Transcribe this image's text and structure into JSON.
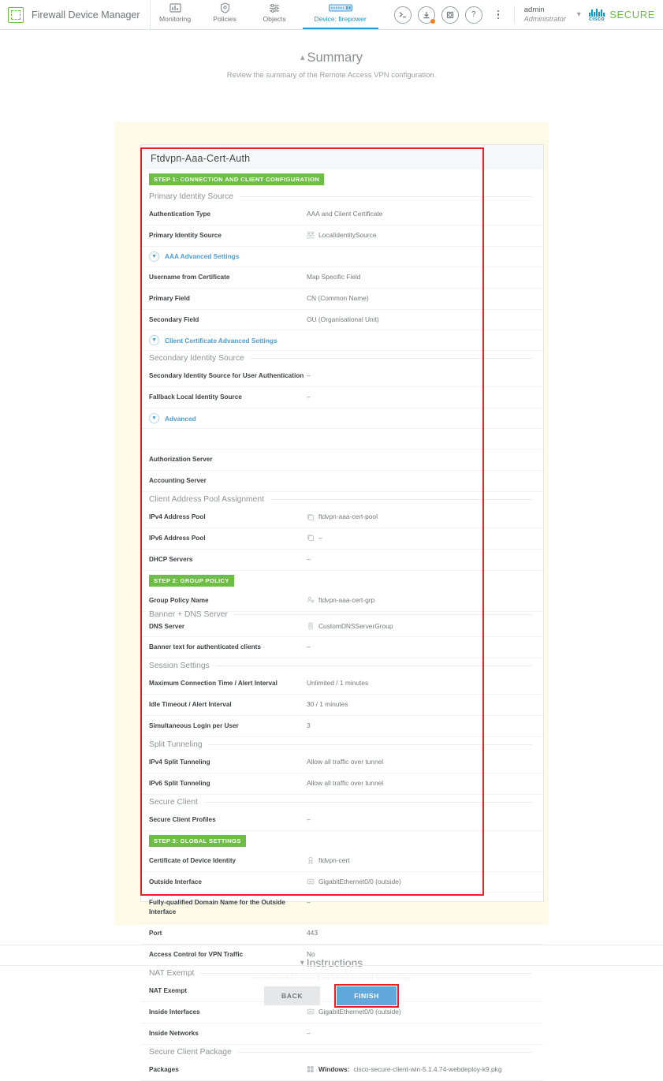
{
  "header": {
    "brand": "Firewall Device Manager",
    "brand_logo_icon": "firewall-logo-icon",
    "tabs": [
      {
        "label": "Monitoring",
        "icon": "monitoring-icon",
        "active": false
      },
      {
        "label": "Policies",
        "icon": "shield-icon",
        "active": false
      },
      {
        "label": "Objects",
        "icon": "objects-icon",
        "active": false
      },
      {
        "label": "Device: firepower",
        "icon": "device-icon",
        "active": true
      }
    ],
    "actions": [
      {
        "name": "cli-console-icon",
        "glyph": ">_"
      },
      {
        "name": "deploy-icon",
        "glyph": "⤓",
        "badge": true
      },
      {
        "name": "tasks-icon",
        "glyph": "◎"
      },
      {
        "name": "help-icon",
        "glyph": "?"
      }
    ],
    "more_icon": "kebab-menu-icon",
    "user": {
      "name": "admin",
      "role": "Administrator"
    },
    "user_chevron_icon": "chevron-down-icon",
    "cisco_logo": "cisco-logo-icon",
    "cisco_word": "cisco",
    "secure_word": "SECURE"
  },
  "summary": {
    "chevron_icon": "chevron-up-icon",
    "title": "Summary",
    "subtitle": "Review the summary of the Remote Access VPN configuration."
  },
  "card": {
    "title": "Ftdvpn-Aaa-Cert-Auth",
    "blocks": [
      {
        "type": "badge",
        "label": "STEP 1: CONNECTION AND CLIENT CONFIGURATION"
      },
      {
        "type": "section",
        "label": "Primary Identity Source"
      },
      {
        "type": "row",
        "key": "Authentication Type",
        "value": "AAA and Client Certificate",
        "icon": ""
      },
      {
        "type": "row",
        "key": "Primary Identity Source",
        "value": "LocalIdentitySource",
        "icon": "identity-source-icon"
      },
      {
        "type": "link",
        "label": "AAA Advanced Settings",
        "icon": "chevron-down-circle-icon"
      },
      {
        "type": "row",
        "key": "Username from Certificate",
        "value": "Map Specific Field",
        "icon": ""
      },
      {
        "type": "row",
        "key": "Primary Field",
        "value": "CN (Common Name)",
        "icon": ""
      },
      {
        "type": "row",
        "key": "Secondary Field",
        "value": "OU (Organisational Unit)",
        "icon": ""
      },
      {
        "type": "link",
        "label": "Client Certificate Advanced Settings",
        "icon": "chevron-down-circle-icon"
      },
      {
        "type": "section",
        "label": "Secondary Identity Source"
      },
      {
        "type": "row",
        "key": "Secondary Identity Source for User Authentication",
        "value": "–",
        "icon": ""
      },
      {
        "type": "row",
        "key": "Fallback Local Identity Source",
        "value": "–",
        "icon": ""
      },
      {
        "type": "link",
        "label": "Advanced",
        "icon": "chevron-down-circle-icon"
      },
      {
        "type": "spacer"
      },
      {
        "type": "row",
        "key": "Authorization Server",
        "value": "",
        "icon": ""
      },
      {
        "type": "row",
        "key": "Accounting Server",
        "value": "",
        "icon": ""
      },
      {
        "type": "section",
        "label": "Client Address Pool Assignment"
      },
      {
        "type": "row",
        "key": "IPv4 Address Pool",
        "value": "ftdvpn-aaa-cert-pool",
        "icon": "network-object-icon"
      },
      {
        "type": "row",
        "key": "IPv6 Address Pool",
        "value": "–",
        "icon": "network-object-icon"
      },
      {
        "type": "row",
        "key": "DHCP Servers",
        "value": "–",
        "icon": ""
      },
      {
        "type": "badge",
        "label": "STEP 2: GROUP POLICY"
      },
      {
        "type": "row",
        "key": "Group Policy Name",
        "value": "ftdvpn-aaa-cert-grp",
        "icon": "group-policy-icon"
      },
      {
        "type": "section",
        "label": "Banner + DNS Server"
      },
      {
        "type": "row",
        "key": "DNS Server",
        "value": "CustomDNSServerGroup",
        "icon": "dns-server-icon"
      },
      {
        "type": "row",
        "key": "Banner text for authenticated clients",
        "value": "–",
        "icon": ""
      },
      {
        "type": "section",
        "label": "Session Settings"
      },
      {
        "type": "row",
        "key": "Maximum Connection Time / Alert Interval",
        "value": "Unlimited / 1 minutes",
        "icon": ""
      },
      {
        "type": "row",
        "key": "Idle Timeout / Alert Interval",
        "value": "30 / 1 minutes",
        "icon": ""
      },
      {
        "type": "row",
        "key": "Simultaneous Login per User",
        "value": "3",
        "icon": ""
      },
      {
        "type": "section",
        "label": "Split Tunneling"
      },
      {
        "type": "row",
        "key": "IPv4 Split Tunneling",
        "value": "Allow all traffic over tunnel",
        "icon": ""
      },
      {
        "type": "row",
        "key": "IPv6 Split Tunneling",
        "value": "Allow all traffic over tunnel",
        "icon": ""
      },
      {
        "type": "section",
        "label": "Secure Client"
      },
      {
        "type": "row",
        "key": "Secure Client Profiles",
        "value": "–",
        "icon": ""
      },
      {
        "type": "badge",
        "label": "STEP 3: GLOBAL SETTINGS"
      },
      {
        "type": "row",
        "key": "Certificate of Device Identity",
        "value": "ftdvpn-cert",
        "icon": "certificate-icon"
      },
      {
        "type": "row",
        "key": "Outside Interface",
        "value": "GigabitEthernet0/0 (outside)",
        "icon": "interface-icon"
      },
      {
        "type": "row",
        "key": "Fully-qualified Domain Name for the Outside Interface",
        "value": "–",
        "icon": ""
      },
      {
        "type": "row",
        "key": "Port",
        "value": "443",
        "icon": ""
      },
      {
        "type": "row",
        "key": "Access Control for VPN Traffic",
        "value": "No",
        "icon": ""
      },
      {
        "type": "section",
        "label": "NAT Exempt"
      },
      {
        "type": "row",
        "key": "NAT Exempt",
        "value": "No",
        "icon": ""
      },
      {
        "type": "row",
        "key": "Inside Interfaces",
        "value": "GigabitEthernet0/0 (outside)",
        "icon": "interface-icon"
      },
      {
        "type": "row",
        "key": "Inside Networks",
        "value": "–",
        "icon": ""
      },
      {
        "type": "section",
        "label": "Secure Client Package"
      },
      {
        "type": "row",
        "key": "Packages",
        "value": "cisco-secure-client-win-5.1.4.74-webdeploy-k9.pkg",
        "value_prefix": "Windows:",
        "icon": "package-icon"
      }
    ]
  },
  "instructions": {
    "chevron_icon": "chevron-down-icon",
    "title": "Instructions",
    "faded_text": "Instructions for your End Users to start connecting"
  },
  "footer": {
    "back_label": "BACK",
    "finish_label": "FINISH"
  },
  "colors": {
    "accent_blue": "#1f9ad6",
    "green": "#6cbe45",
    "annotation_red": "#ee1d24",
    "finish_blue": "#63a8dd",
    "band_cream": "#fdfbe8"
  }
}
